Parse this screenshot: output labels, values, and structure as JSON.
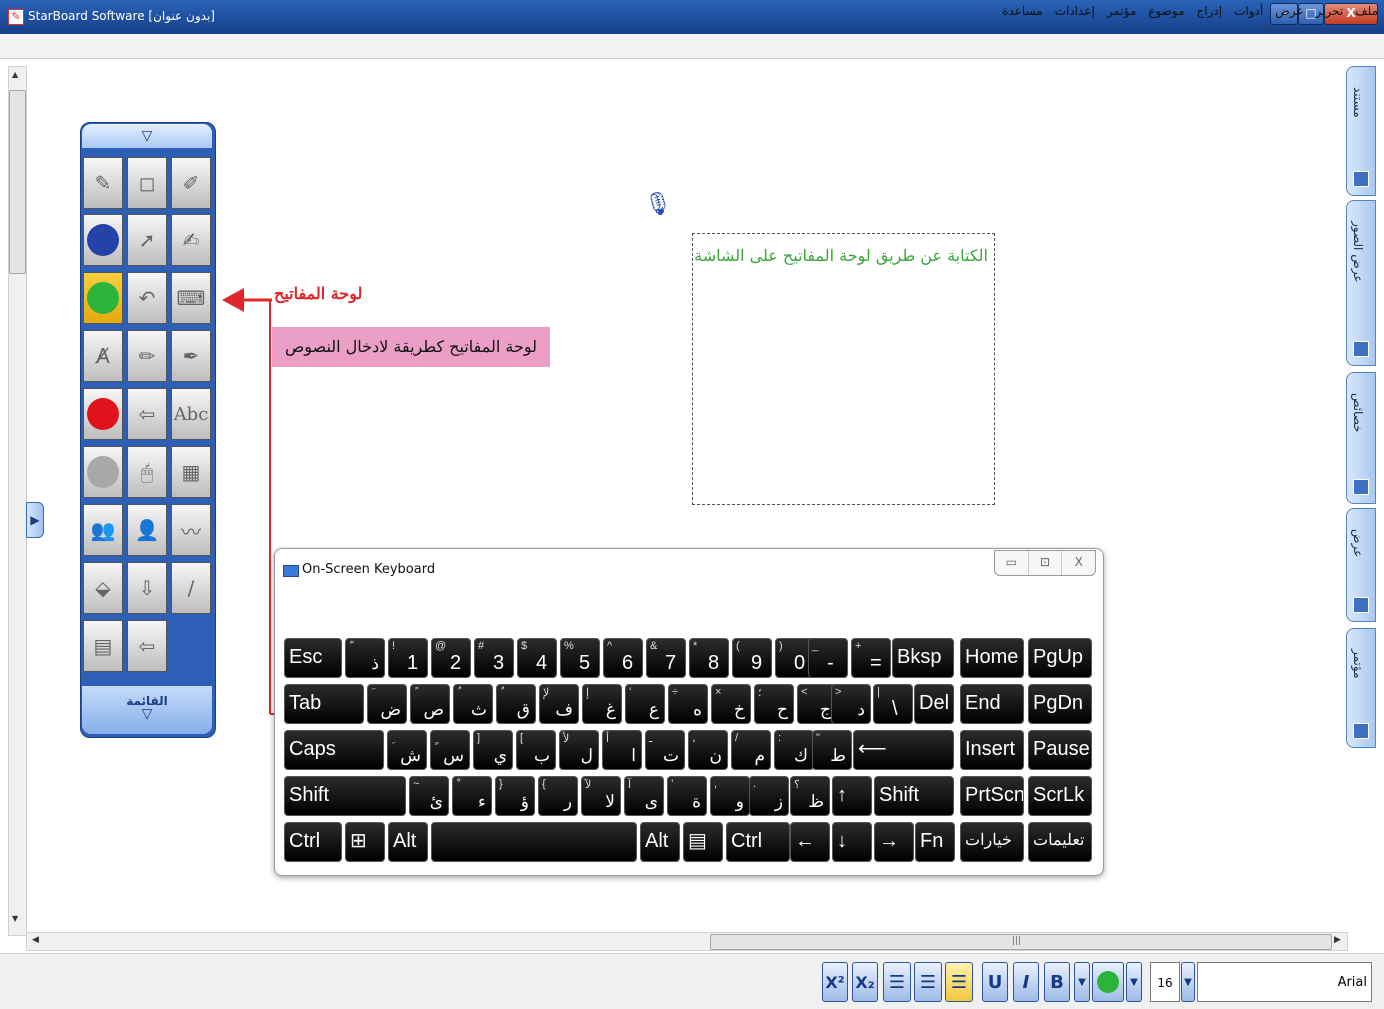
{
  "window": {
    "title": "StarBoard Software [بدون عنوان]",
    "min": "–",
    "max": "□",
    "close": "X"
  },
  "menu": [
    "ملف",
    "تحرير",
    "عرض",
    "أدوات",
    "إدراج",
    "موضوع",
    "مؤتمر",
    "إعدادات",
    "مساعدة"
  ],
  "right_tabs": [
    "مستند",
    "عرض الصور",
    "خصائص",
    "عرض",
    "مؤتمر"
  ],
  "palette": {
    "menu_label": "القائمة",
    "abc": "Abc"
  },
  "annotation": {
    "title": "لوحة المفاتيح",
    "note": "لوحة المفاتيح كطريقة لادخال النصوص"
  },
  "canvas": {
    "text": "الكتابة عن طريق لوحة المفاتيح على الشاشة"
  },
  "osk": {
    "title": "On-Screen Keyboard",
    "ctrl_min": "▭",
    "ctrl_max": "⊡",
    "ctrl_close": "X"
  },
  "keys": {
    "row1": [
      {
        "m": "Esc",
        "s": "",
        "a": ""
      },
      {
        "m": "",
        "s": "ّ",
        "a": "ذ"
      },
      {
        "m": "1",
        "s": "!",
        "a": ""
      },
      {
        "m": "2",
        "s": "@",
        "a": ""
      },
      {
        "m": "3",
        "s": "#",
        "a": ""
      },
      {
        "m": "4",
        "s": "$",
        "a": ""
      },
      {
        "m": "5",
        "s": "%",
        "a": ""
      },
      {
        "m": "6",
        "s": "^",
        "a": ""
      },
      {
        "m": "7",
        "s": "&",
        "a": ""
      },
      {
        "m": "8",
        "s": "*",
        "a": ""
      },
      {
        "m": "9",
        "s": "(",
        "a": ""
      },
      {
        "m": "0",
        "s": ")",
        "a": ""
      },
      {
        "m": "-",
        "s": "_",
        "a": ""
      },
      {
        "m": "=",
        "s": "+",
        "a": ""
      },
      {
        "m": "Bksp",
        "s": "",
        "a": ""
      },
      {
        "m": "Home",
        "s": "",
        "a": ""
      },
      {
        "m": "PgUp",
        "s": "",
        "a": ""
      }
    ],
    "row2": [
      {
        "m": "Tab",
        "s": "",
        "a": ""
      },
      {
        "m": "",
        "s": "َ",
        "a": "ض"
      },
      {
        "m": "",
        "s": "ً",
        "a": "ص"
      },
      {
        "m": "",
        "s": "ُ",
        "a": "ث"
      },
      {
        "m": "",
        "s": "ٌ",
        "a": "ق"
      },
      {
        "m": "",
        "s": "لإ",
        "a": "ف"
      },
      {
        "m": "",
        "s": "إ",
        "a": "غ"
      },
      {
        "m": "",
        "s": "‘",
        "a": "ع"
      },
      {
        "m": "",
        "s": "÷",
        "a": "ه"
      },
      {
        "m": "",
        "s": "×",
        "a": "خ"
      },
      {
        "m": "",
        "s": "؛",
        "a": "ح"
      },
      {
        "m": "",
        "s": "<",
        "a": "ج"
      },
      {
        "m": "",
        "s": ">",
        "a": "د"
      },
      {
        "m": "\\",
        "s": "|",
        "a": ""
      },
      {
        "m": "Del",
        "s": "",
        "a": ""
      },
      {
        "m": "End",
        "s": "",
        "a": ""
      },
      {
        "m": "PgDn",
        "s": "",
        "a": ""
      }
    ],
    "row3": [
      {
        "m": "Caps",
        "s": "",
        "a": ""
      },
      {
        "m": "",
        "s": "ِ",
        "a": "ش"
      },
      {
        "m": "",
        "s": "ٍ",
        "a": "س"
      },
      {
        "m": "",
        "s": "]",
        "a": "ي"
      },
      {
        "m": "",
        "s": "[",
        "a": "ب"
      },
      {
        "m": "",
        "s": "لأ",
        "a": "ل"
      },
      {
        "m": "",
        "s": "أ",
        "a": "ا"
      },
      {
        "m": "",
        "s": "ـ",
        "a": "ت"
      },
      {
        "m": "",
        "s": "،",
        "a": "ن"
      },
      {
        "m": "",
        "s": "/",
        "a": "م"
      },
      {
        "m": "",
        "s": ":",
        "a": "ك"
      },
      {
        "m": "",
        "s": "\"",
        "a": "ط"
      },
      {
        "m": "⟵",
        "s": "",
        "a": ""
      },
      {
        "m": "Insert",
        "s": "",
        "a": ""
      },
      {
        "m": "Pause",
        "s": "",
        "a": ""
      }
    ],
    "row4": [
      {
        "m": "Shift",
        "s": "",
        "a": ""
      },
      {
        "m": "",
        "s": "~",
        "a": "ئ"
      },
      {
        "m": "",
        "s": "ْ",
        "a": "ء"
      },
      {
        "m": "",
        "s": "}",
        "a": "ؤ"
      },
      {
        "m": "",
        "s": "{",
        "a": "ر"
      },
      {
        "m": "",
        "s": "لآ",
        "a": "لا"
      },
      {
        "m": "",
        "s": "آ",
        "a": "ى"
      },
      {
        "m": "",
        "s": "’",
        "a": "ة"
      },
      {
        "m": "",
        "s": ",",
        "a": "و"
      },
      {
        "m": "",
        "s": ".",
        "a": "ز"
      },
      {
        "m": "",
        "s": "؟",
        "a": "ظ"
      },
      {
        "m": "↑",
        "s": "",
        "a": ""
      },
      {
        "m": "Shift",
        "s": "",
        "a": ""
      },
      {
        "m": "PrtScn",
        "s": "",
        "a": ""
      },
      {
        "m": "ScrLk",
        "s": "",
        "a": ""
      }
    ],
    "row5": [
      {
        "m": "Ctrl",
        "s": "",
        "a": ""
      },
      {
        "m": "⊞",
        "s": "",
        "a": ""
      },
      {
        "m": "Alt",
        "s": "",
        "a": ""
      },
      {
        "m": "",
        "s": "",
        "a": ""
      },
      {
        "m": "Alt",
        "s": "",
        "a": ""
      },
      {
        "m": "▤",
        "s": "",
        "a": ""
      },
      {
        "m": "Ctrl",
        "s": "",
        "a": ""
      },
      {
        "m": "←",
        "s": "",
        "a": ""
      },
      {
        "m": "↓",
        "s": "",
        "a": ""
      },
      {
        "m": "→",
        "s": "",
        "a": ""
      },
      {
        "m": "Fn",
        "s": "",
        "a": ""
      },
      {
        "m": "خيارات",
        "s": "",
        "a": ""
      },
      {
        "m": "تعليمات",
        "s": "",
        "a": ""
      }
    ]
  },
  "format_bar": {
    "sup": "X²",
    "sub": "X₂",
    "u": "U",
    "i": "I",
    "b": "B",
    "size": "16",
    "font": "Arial"
  },
  "scroll": {
    "grip": "|||"
  }
}
